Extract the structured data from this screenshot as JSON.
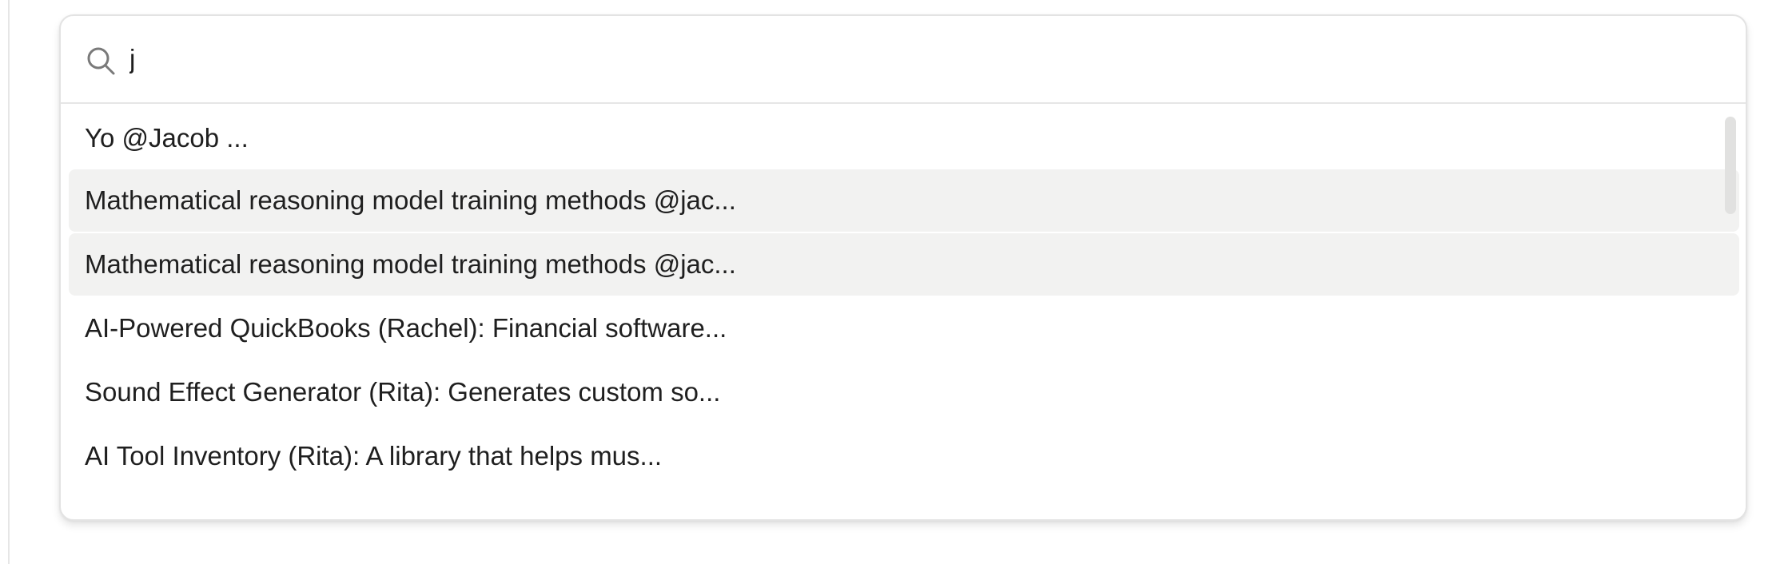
{
  "search": {
    "value": "j",
    "icon": "search-icon"
  },
  "results": [
    {
      "label": "Yo @Jacob ...",
      "highlighted": false
    },
    {
      "label": "Mathematical reasoning model training methods @jac...",
      "highlighted": true
    },
    {
      "label": "Mathematical reasoning model training methods @jac...",
      "highlighted": true
    },
    {
      "label": "AI-Powered QuickBooks (Rachel): Financial software...",
      "highlighted": false
    },
    {
      "label": "Sound Effect Generator (Rita): Generates custom so...",
      "highlighted": false
    },
    {
      "label": "AI Tool Inventory (Rita): A library that helps mus...",
      "highlighted": false
    }
  ],
  "colors": {
    "highlight": "#f2f2f1",
    "border": "#e3e3e3",
    "text": "#1f1f1f",
    "icon": "#7a7a7a"
  }
}
